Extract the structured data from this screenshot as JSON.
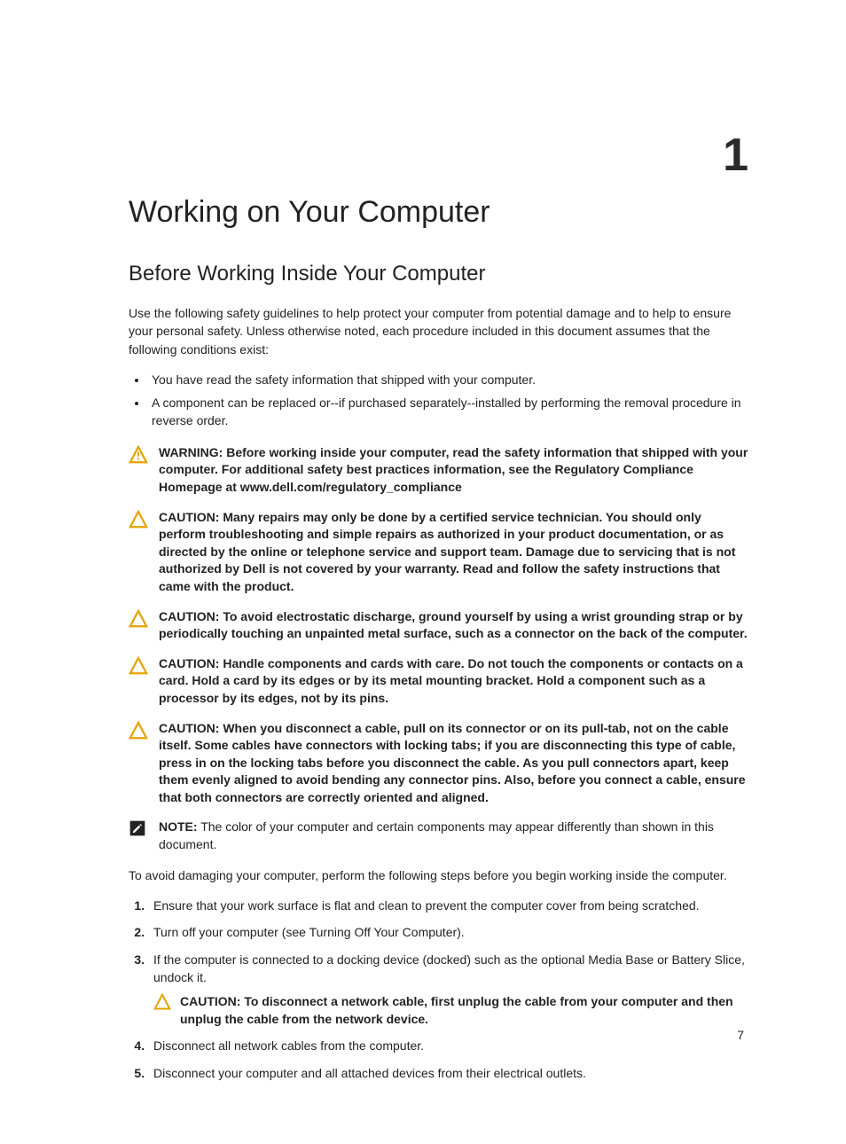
{
  "chapter_number": "1",
  "title": "Working on Your Computer",
  "subtitle": "Before Working Inside Your Computer",
  "intro": "Use the following safety guidelines to help protect your computer from potential damage and to help to ensure your personal safety. Unless otherwise noted, each procedure included in this document assumes that the following conditions exist:",
  "bullets": [
    "You have read the safety information that shipped with your computer.",
    "A component can be replaced or--if purchased separately--installed by performing the removal procedure in reverse order."
  ],
  "callouts": [
    {
      "type": "warning",
      "label": "WARNING:",
      "text": " Before working inside your computer, read the safety information that shipped with your computer. For additional safety best practices information, see the Regulatory Compliance Homepage at www.dell.com/regulatory_compliance"
    },
    {
      "type": "caution",
      "label": "CAUTION:",
      "text": " Many repairs may only be done by a certified service technician. You should only perform troubleshooting and simple repairs as authorized in your product documentation, or as directed by the online or telephone service and support team. Damage due to servicing that is not authorized by Dell is not covered by your warranty. Read and follow the safety instructions that came with the product."
    },
    {
      "type": "caution",
      "label": "CAUTION:",
      "text": " To avoid electrostatic discharge, ground yourself by using a wrist grounding strap or by periodically touching an unpainted metal surface, such as a connector on the back of the computer."
    },
    {
      "type": "caution",
      "label": "CAUTION:",
      "text": " Handle components and cards with care. Do not touch the components or contacts on a card. Hold a card by its edges or by its metal mounting bracket. Hold a component such as a processor by its edges, not by its pins."
    },
    {
      "type": "caution",
      "label": "CAUTION:",
      "text": " When you disconnect a cable, pull on its connector or on its pull-tab, not on the cable itself. Some cables have connectors with locking tabs; if you are disconnecting this type of cable, press in on the locking tabs before you disconnect the cable. As you pull connectors apart, keep them evenly aligned to avoid bending any connector pins. Also, before you connect a cable, ensure that both connectors are correctly oriented and aligned."
    },
    {
      "type": "note",
      "label": "NOTE:",
      "text": " The color of your computer and certain components may appear differently than shown in this document."
    }
  ],
  "transition": "To avoid damaging your computer, perform the following steps before you begin working inside the computer.",
  "steps": [
    {
      "text": "Ensure that your work surface is flat and clean to prevent the computer cover from being scratched."
    },
    {
      "text": "Turn off your computer (see Turning Off Your Computer)."
    },
    {
      "text": "If the computer is connected to a docking device (docked) such as the optional Media Base or Battery Slice, undock it.",
      "nested": {
        "label": "CAUTION:",
        "text": " To disconnect a network cable, first unplug the cable from your computer and then unplug the cable from the network device."
      }
    },
    {
      "text": "Disconnect all network cables from the computer."
    },
    {
      "text": "Disconnect your computer and all attached devices from their electrical outlets."
    }
  ],
  "page_number": "7"
}
